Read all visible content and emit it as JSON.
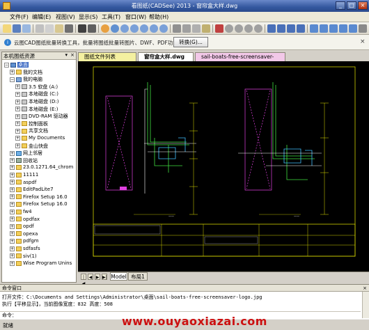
{
  "window": {
    "title": "看图纸(CADSee) 2013 - 窗帘盒大样.dwg"
  },
  "menu": [
    "文件(F)",
    "编辑(E)",
    "视图(V)",
    "显示(S)",
    "工具(T)",
    "窗口(W)",
    "帮助(H)"
  ],
  "infobar": {
    "message": "云图CAD图纸批量转换工具，批量将图纸批量转图片、DWF、PDF功能",
    "button_label": "转换(G)..."
  },
  "left_pane": {
    "title": "本机图纸资源",
    "tree": [
      {
        "label": "桌面",
        "depth": 0,
        "icon": "desktop-icon",
        "selected": true
      },
      {
        "label": "我的文档",
        "depth": 1,
        "icon": "folder-icon"
      },
      {
        "label": "我的电脑",
        "depth": 1,
        "icon": "computer-icon"
      },
      {
        "label": "3.5 软盘 (A:)",
        "depth": 2,
        "icon": "floppy-icon"
      },
      {
        "label": "本地磁盘 (C:)",
        "depth": 2,
        "icon": "disk-icon"
      },
      {
        "label": "本地磁盘 (D:)",
        "depth": 2,
        "icon": "disk-icon"
      },
      {
        "label": "本地磁盘 (E:)",
        "depth": 2,
        "icon": "disk-icon"
      },
      {
        "label": "DVD-RAM 驱动器",
        "depth": 2,
        "icon": "dvd-icon"
      },
      {
        "label": "控制面板",
        "depth": 2,
        "icon": "folder-icon"
      },
      {
        "label": "共享文档",
        "depth": 2,
        "icon": "folder-icon"
      },
      {
        "label": "My Documents",
        "depth": 2,
        "icon": "folder-icon"
      },
      {
        "label": "金山快盘",
        "depth": 2,
        "icon": "folder-icon"
      },
      {
        "label": "网上邻居",
        "depth": 1,
        "icon": "network-icon"
      },
      {
        "label": "回收站",
        "depth": 1,
        "icon": "recycle-bin-icon"
      },
      {
        "label": "23.0.1271.64_chrom",
        "depth": 1,
        "icon": "folder-icon"
      },
      {
        "label": "11111",
        "depth": 1,
        "icon": "folder-icon"
      },
      {
        "label": "aspdf",
        "depth": 1,
        "icon": "folder-icon"
      },
      {
        "label": "EditPadLite7",
        "depth": 1,
        "icon": "folder-icon"
      },
      {
        "label": "Firefox Setup 16.0",
        "depth": 1,
        "icon": "folder-icon"
      },
      {
        "label": "Firefox Setup 16.0",
        "depth": 1,
        "icon": "folder-icon"
      },
      {
        "label": "fw4",
        "depth": 1,
        "icon": "folder-icon"
      },
      {
        "label": "opdfax",
        "depth": 1,
        "icon": "folder-icon"
      },
      {
        "label": "opdf",
        "depth": 1,
        "icon": "folder-icon"
      },
      {
        "label": "opexa",
        "depth": 1,
        "icon": "folder-icon"
      },
      {
        "label": "pdfgm",
        "depth": 1,
        "icon": "folder-icon"
      },
      {
        "label": "sdfasfs",
        "depth": 1,
        "icon": "folder-icon"
      },
      {
        "label": "siv(1)",
        "depth": 1,
        "icon": "folder-icon"
      },
      {
        "label": "Wise Program Unins",
        "depth": 1,
        "icon": "folder-icon"
      }
    ]
  },
  "tabs": [
    "图纸文件列表",
    "窗帘盒大样.dwg",
    "sail-boats-free-screensaver-logo.jpg"
  ],
  "model_tabs": {
    "model": "Model",
    "layout": "布局1"
  },
  "command_window": {
    "title": "命令窗口",
    "lines": [
      "打开文件：C:\\Documents and Settings\\Administrator\\桌面\\sail-boats-free-screensaver-logo.jpg",
      "执行【平移显示】，当前图像宽度：832 高度：508"
    ],
    "prompt": "命令："
  },
  "status": {
    "text": "就绪"
  },
  "watermark": "www.ouyaoxiazai.com"
}
